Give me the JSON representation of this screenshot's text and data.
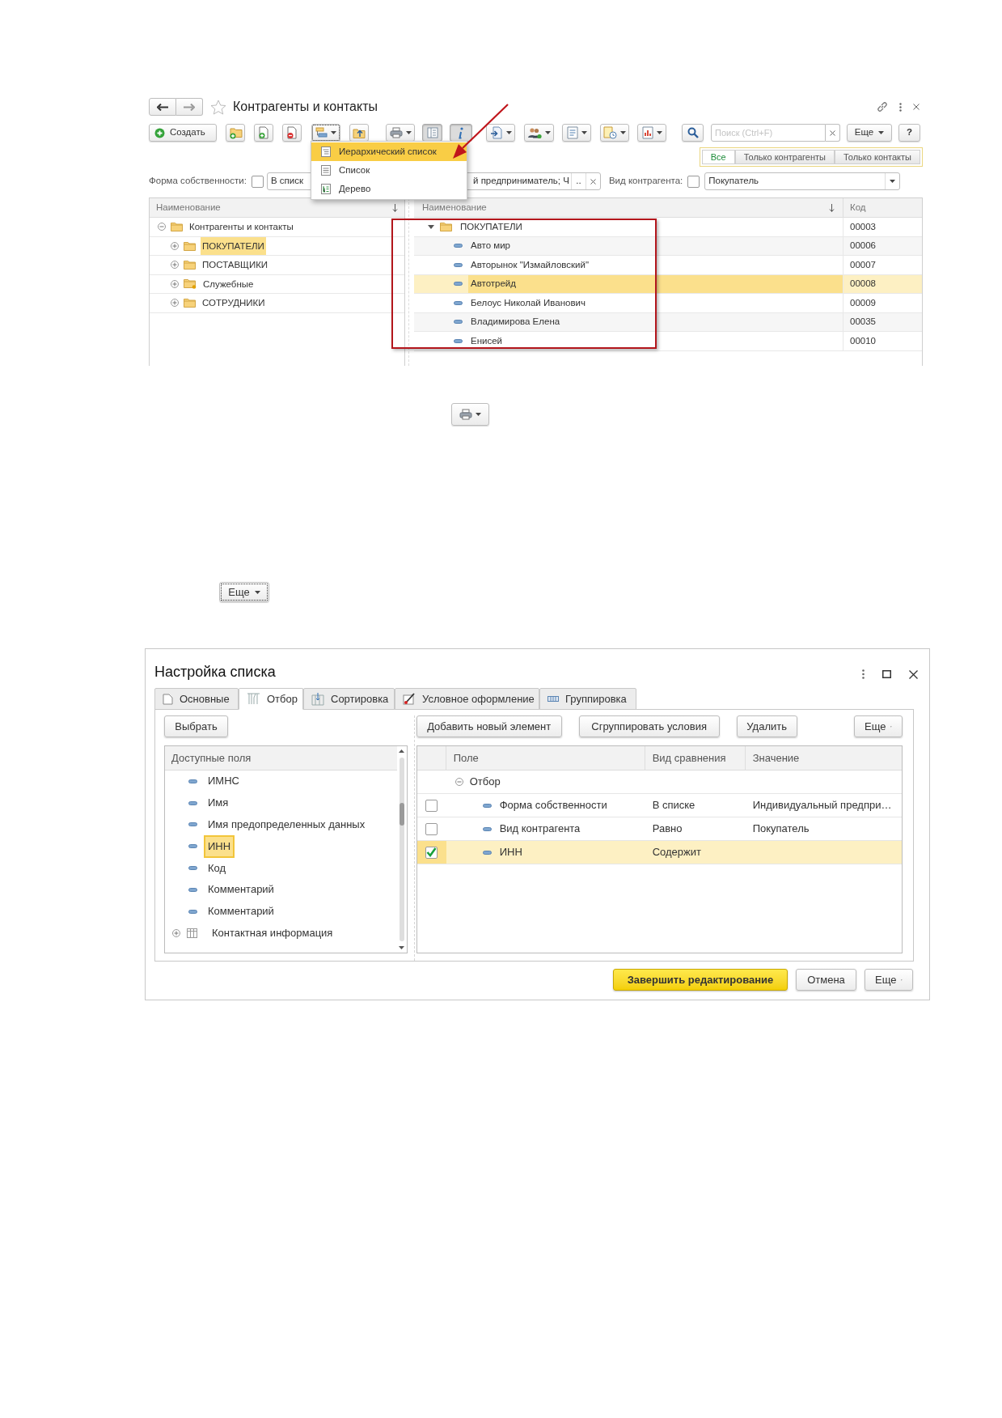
{
  "main_window": {
    "title": "Контрагенты и контакты",
    "toolbar": {
      "create_label": "Создать",
      "list_pane_pressed": true,
      "info_pressed": true,
      "search_placeholder": "Поиск (Ctrl+F)",
      "more_label": "Еще",
      "help_label": "?"
    },
    "view_menu": [
      {
        "label": "Иерархический список",
        "selected": true
      },
      {
        "label": "Список",
        "selected": false
      },
      {
        "label": "Дерево",
        "selected": false
      }
    ],
    "segments": [
      {
        "label": "Все",
        "selected": true
      },
      {
        "label": "Только контрагенты",
        "selected": false
      },
      {
        "label": "Только контакты",
        "selected": false
      }
    ],
    "filters": [
      {
        "kind": "list",
        "label": "Форма собственности:",
        "checked": false,
        "value_start": "В списк",
        "value_end": "й предприниматель; Ч",
        "choice_button": ".."
      },
      {
        "kind": "select",
        "label": "Вид контрагента:",
        "checked": false,
        "value": "Покупатель"
      }
    ],
    "groups": {
      "header": "Наименование",
      "items": [
        {
          "label": "Контрагенты и контакты",
          "kind": "folder",
          "expanded": true,
          "selected": false,
          "children": [
            {
              "label": "ПОКУПАТЕЛИ",
              "kind": "folder",
              "expanded": false,
              "selected": true
            },
            {
              "label": "ПОСТАВЩИКИ",
              "kind": "folder",
              "expanded": false,
              "selected": false
            },
            {
              "label": "Служебные",
              "kind": "special",
              "expanded": false,
              "selected": false
            },
            {
              "label": "СОТРУДНИКИ",
              "kind": "folder",
              "expanded": false,
              "selected": false
            }
          ]
        }
      ]
    },
    "list": {
      "columns": [
        "Наименование",
        "Код"
      ],
      "rows": [
        {
          "kind": "folder",
          "name": "ПОКУПАТЕЛИ",
          "code": "00003",
          "expanded": true,
          "selected": false,
          "children": [
            {
              "kind": "item",
              "name": "Авто мир",
              "code": "00006",
              "selected": false
            },
            {
              "kind": "item",
              "name": "Авторынок \"Измайловский\"",
              "code": "00007",
              "selected": false
            },
            {
              "kind": "item",
              "name": "Автотрейд",
              "code": "00008",
              "selected": true
            },
            {
              "kind": "item",
              "name": "Белоус Николай Иванович",
              "code": "00009",
              "selected": false
            },
            {
              "kind": "item",
              "name": "Владимирова Елена",
              "code": "00035",
              "selected": false
            },
            {
              "kind": "item",
              "name": "Енисей",
              "code": "00010",
              "selected": false
            }
          ]
        }
      ]
    }
  },
  "print_button": {
    "kind": "dropdown"
  },
  "more_button": {
    "label": "Еще"
  },
  "dialog": {
    "title": "Настройка списка",
    "tabs": [
      {
        "label": "Основные",
        "selected": false
      },
      {
        "label": "Отбор",
        "selected": true
      },
      {
        "label": "Сортировка",
        "selected": false
      },
      {
        "label": "Условное оформление",
        "selected": false
      },
      {
        "label": "Группировка",
        "selected": false
      }
    ],
    "select_button": "Выбрать",
    "available_fields": {
      "header": "Доступные поля",
      "items": [
        {
          "kind": "field",
          "label": "ИМНС",
          "selected": false
        },
        {
          "kind": "field",
          "label": "Имя",
          "selected": false
        },
        {
          "kind": "field",
          "label": "Имя предопределенных данных",
          "selected": false
        },
        {
          "kind": "field",
          "label": "ИНН",
          "selected": true
        },
        {
          "kind": "field",
          "label": "Код",
          "selected": false
        },
        {
          "kind": "field",
          "label": "Комментарий",
          "selected": false
        },
        {
          "kind": "field",
          "label": "Комментарий",
          "selected": false
        },
        {
          "kind": "group",
          "label": "Контактная информация",
          "selected": false,
          "expanded": false
        }
      ]
    },
    "actions": [
      "Добавить новый элемент",
      "Сгруппировать условия",
      "Удалить"
    ],
    "actions_more": "Еще",
    "conditions": {
      "columns": [
        "Поле",
        "Вид сравнения",
        "Значение"
      ],
      "groups": [
        {
          "label": "Отбор",
          "expanded": true,
          "children": [
            {
              "field": "Форма собственности",
              "comparison": "В списке",
              "value": "Индивидуальный предпри…",
              "checked": false,
              "selected": false
            },
            {
              "field": "Вид контрагента",
              "comparison": "Равно",
              "value": "Покупатель",
              "checked": false,
              "selected": false
            },
            {
              "field": "ИНН",
              "comparison": "Содержит",
              "checked": true,
              "selected": true
            }
          ]
        }
      ]
    },
    "footer_buttons": [
      {
        "kind": "primary",
        "label": "Завершить редактирование"
      },
      {
        "kind": "default",
        "label": "Отмена"
      },
      {
        "kind": "menu",
        "label": "Еще"
      }
    ]
  }
}
